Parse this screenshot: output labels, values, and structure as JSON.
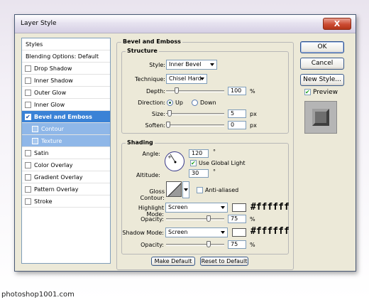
{
  "window": {
    "title": "Layer Style",
    "close_label": "X"
  },
  "sidebar": {
    "header": "Styles",
    "blending": "Blending Options: Default",
    "items": [
      {
        "label": "Drop Shadow",
        "checked": false
      },
      {
        "label": "Inner Shadow",
        "checked": false
      },
      {
        "label": "Outer Glow",
        "checked": false
      },
      {
        "label": "Inner Glow",
        "checked": false
      },
      {
        "label": "Bevel and Emboss",
        "checked": true
      },
      {
        "label": "Contour",
        "checked": false
      },
      {
        "label": "Texture",
        "checked": false
      },
      {
        "label": "Satin",
        "checked": false
      },
      {
        "label": "Color Overlay",
        "checked": false
      },
      {
        "label": "Gradient Overlay",
        "checked": false
      },
      {
        "label": "Pattern Overlay",
        "checked": false
      },
      {
        "label": "Stroke",
        "checked": false
      }
    ]
  },
  "bevel": {
    "title": "Bevel and Emboss",
    "structure": {
      "title": "Structure",
      "style_label": "Style:",
      "style_value": "Inner Bevel",
      "technique_label": "Technique:",
      "technique_value": "Chisel Hard",
      "depth_label": "Depth:",
      "depth_value": "100",
      "depth_unit": "%",
      "direction_label": "Direction:",
      "dir_up": "Up",
      "dir_down": "Down",
      "size_label": "Size:",
      "size_value": "5",
      "size_unit": "px",
      "soften_label": "Soften:",
      "soften_value": "0",
      "soften_unit": "px"
    },
    "shading": {
      "title": "Shading",
      "angle_label": "Angle:",
      "angle_value": "120",
      "angle_unit": "°",
      "global_light": "Use Global Light",
      "altitude_label": "Altitude:",
      "altitude_value": "30",
      "altitude_unit": "°",
      "gloss_label": "Gloss Contour:",
      "anti_aliased": "Anti-aliased",
      "highlight_label": "Highlight Mode:",
      "highlight_mode": "Screen",
      "highlight_color": "#ffffff",
      "highlight_hex": "#ffffff",
      "opacity_label": "Opacity:",
      "hl_opacity": "75",
      "opacity_unit": "%",
      "shadow_label": "Shadow Mode:",
      "shadow_mode": "Screen",
      "shadow_color": "#ffffff",
      "shadow_hex": "#ffffff",
      "sh_opacity": "75"
    },
    "make_default": "Make Default",
    "reset_default": "Reset to Default"
  },
  "buttons": {
    "ok": "OK",
    "cancel": "Cancel",
    "new_style": "New Style...",
    "preview": "Preview"
  },
  "watermark": "photoshop1001.com",
  "colors": {
    "accent": "#3a82d6",
    "sub": "#8fb7e8",
    "panel": "#ece9d8"
  }
}
